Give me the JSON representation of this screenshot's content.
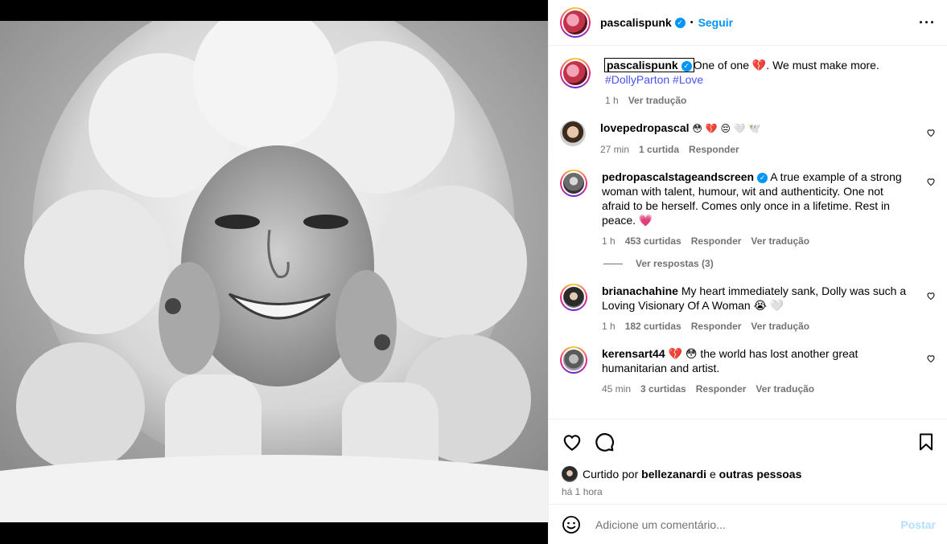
{
  "post": {
    "author": "pascalispunk",
    "follow_label": "Seguir",
    "more_icon": "more-options-icon"
  },
  "caption": {
    "author": "pascalispunk",
    "text": "One of one 💔. We must make more.",
    "hashtags": "#DollyParton #Love",
    "time": "1 h",
    "translate": "Ver tradução"
  },
  "comments": [
    {
      "user": "lovepedropascal",
      "text": "😳 💔 😔 🤍 🕊️",
      "time": "27 min",
      "likes": "1 curtida",
      "reply": "Responder"
    },
    {
      "user": "pedropascalstageandscreen",
      "verified": true,
      "text": "A true example of a strong woman with talent, humour, wit and authenticity. One not afraid to be herself. Comes only once in a lifetime. Rest in peace. 💗",
      "time": "1 h",
      "likes": "453 curtidas",
      "reply": "Responder",
      "translate": "Ver tradução",
      "view_replies": "Ver respostas (3)"
    },
    {
      "user": "brianachahine",
      "text": "My heart immediately sank, Dolly was such a Loving Visionary Of A Woman 😭 🤍",
      "time": "1 h",
      "likes": "182 curtidas",
      "reply": "Responder",
      "translate": "Ver tradução"
    },
    {
      "user": "kerensart44",
      "text": "💔 😳  the world has lost another great humanitarian and artist.",
      "time": "45 min",
      "likes": "3 curtidas",
      "reply": "Responder",
      "translate": "Ver tradução"
    }
  ],
  "liked_by": {
    "prefix": "Curtido por",
    "user": "bellezanardi",
    "connector": "e",
    "others": "outras pessoas",
    "time": "há 1 hora"
  },
  "comment_input": {
    "placeholder": "Adicione um comentário...",
    "post_label": "Postar"
  },
  "colors": {
    "accent": "#0095f6",
    "hashtag": "#4a52f5",
    "muted": "#737373"
  }
}
